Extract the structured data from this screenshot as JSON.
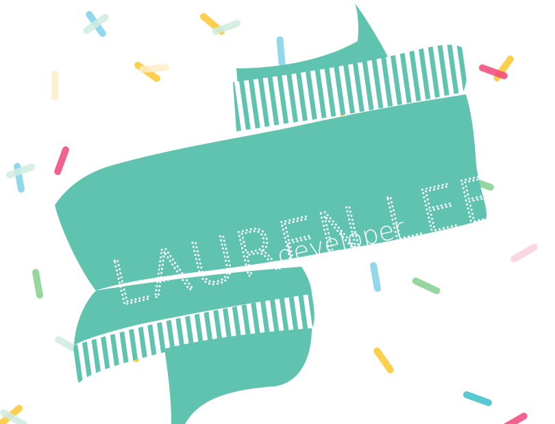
{
  "banner": {
    "name": "LAUREN LEE",
    "role": "developer"
  },
  "colors": {
    "ribbon": "#5fc3b0",
    "ribbon_dark": "#55b6a4",
    "stripe": "#ffffff",
    "background": "#ffffff",
    "sprinkle_blue": "#7fd1e6",
    "sprinkle_yellow": "#fcc72e",
    "sprinkle_pink": "#f0477a",
    "sprinkle_green": "#84d08f",
    "sprinkle_teal": "#3bbfc9",
    "sprinkle_light_pink": "#f9cfdb",
    "sprinkle_mint": "#cfece0",
    "sprinkle_cream": "#fbedc7"
  },
  "decorations": {
    "type": "confetti-sprinkles"
  }
}
